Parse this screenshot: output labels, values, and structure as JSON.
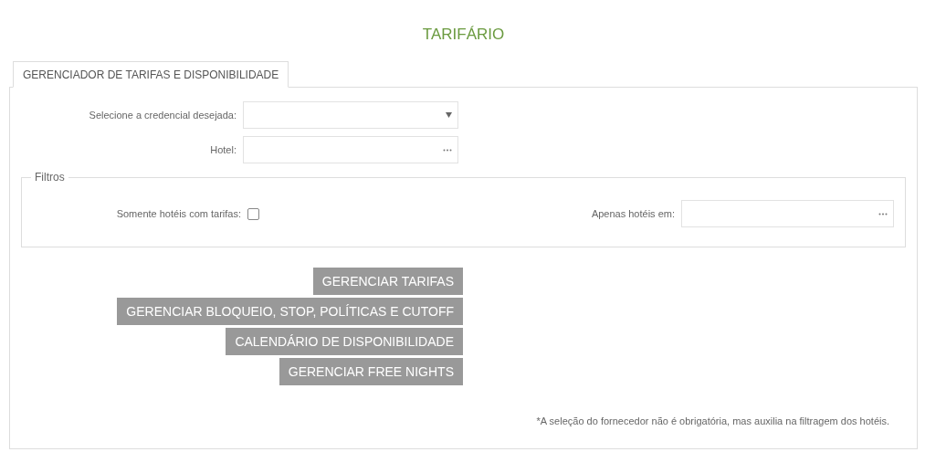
{
  "title": "TARIFÁRIO",
  "tabs": [
    {
      "label": "GERENCIADOR DE TARIFAS E DISPONIBILIDADE",
      "selected": true
    }
  ],
  "form": {
    "credential": {
      "label": "Selecione a credencial desejada:"
    },
    "hotel": {
      "label": "Hotel:"
    }
  },
  "filters": {
    "legend": "Filtros",
    "only_with_rates": {
      "label": "Somente hotéis com tarifas:",
      "checked": false
    },
    "only_hotels_in": {
      "label": "Apenas hotéis em:"
    }
  },
  "buttons": [
    "GERENCIAR TARIFAS",
    "GERENCIAR BLOQUEIO, STOP, POLÍTICAS E CUTOFF",
    "CALENDÁRIO DE DISPONIBILIDADE",
    "GERENCIAR FREE NIGHTS"
  ],
  "footnote": "*A seleção do fornecedor não é obrigatória, mas auxilia na filtragem dos hotéis."
}
